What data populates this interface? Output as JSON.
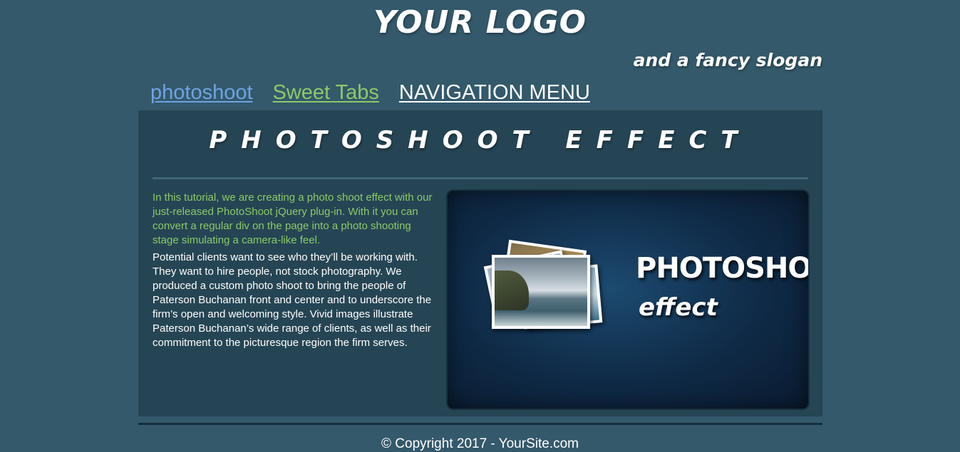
{
  "header": {
    "logo": "YOUR LOGO",
    "slogan": "and a fancy slogan"
  },
  "nav": {
    "items": [
      {
        "label": "photoshoot",
        "color": "#6fa3e3"
      },
      {
        "label": "Sweet Tabs",
        "color": "#8dc968"
      },
      {
        "label": "NAVIGATION MENU",
        "color": "#ffffff"
      }
    ]
  },
  "main": {
    "title": "PHOTOSHOOT EFFECT",
    "intro": "In this tutorial, we are creating a photo shoot effect with our just-released PhotoShoot jQuery plug-in. With it you can convert a regular div on the page into a photo shooting stage simulating a camera-like feel.",
    "body": "Potential clients want to see who they’ll be working with. They want to hire people, not stock photography. We produced a custom photo shoot to bring the people of Paterson Buchanan front and center and to underscore the firm’s open and welcoming style. Vivid images illustrate Paterson Buchanan’s wide range of clients, as well as their commitment to the picturesque region the firm serves.",
    "hero": {
      "title": "PHOTOSHOOT",
      "subtitle": "effect"
    }
  },
  "footer": {
    "copyright": "© Copyright 2017 - YourSite.com"
  },
  "colors": {
    "background": "#33596b",
    "panel": "#254554",
    "accent_green": "#8dc968",
    "link_blue": "#6fa3e3"
  }
}
